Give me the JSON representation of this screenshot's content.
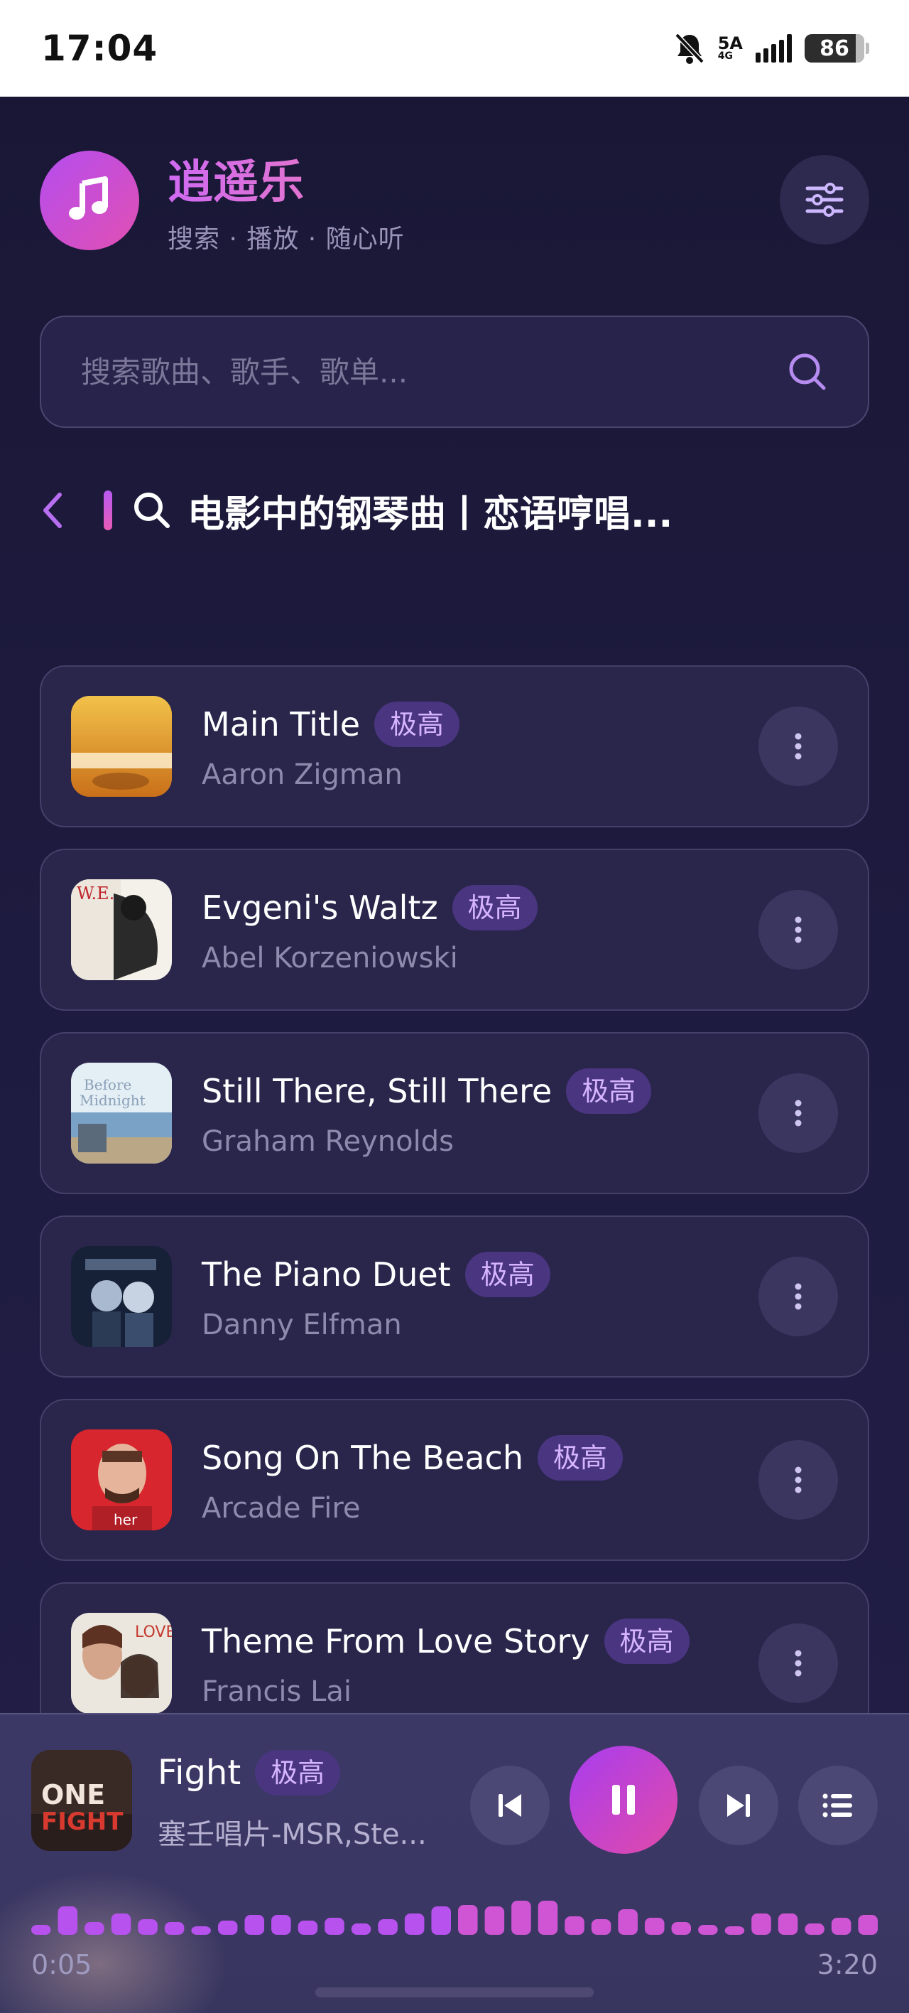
{
  "status_bar": {
    "time": "17:04",
    "network": "5A",
    "network_sub": "4G",
    "battery": "86"
  },
  "header": {
    "app_name": "逍遥乐",
    "subtitle": "搜索 · 播放 · 随心听"
  },
  "search": {
    "placeholder": "搜索歌曲、歌手、歌单..."
  },
  "list": {
    "title": "电影中的钢琴曲丨恋语哼唱..."
  },
  "songs": [
    {
      "title": "Main Title",
      "artist": "Aaron Zigman",
      "quality": "极高",
      "cover_colors": [
        "#f2c24a",
        "#c9701a"
      ]
    },
    {
      "title": "Evgeni's Waltz",
      "artist": "Abel Korzeniowski",
      "quality": "极高",
      "cover_colors": [
        "#f4f0ea",
        "#2a2a2a"
      ]
    },
    {
      "title": "Still There, Still There",
      "artist": "Graham Reynolds",
      "quality": "极高",
      "cover_colors": [
        "#dfeaf2",
        "#6d93b8"
      ]
    },
    {
      "title": "The Piano Duet",
      "artist": "Danny Elfman",
      "quality": "极高",
      "cover_colors": [
        "#1b2740",
        "#5a7190"
      ]
    },
    {
      "title": "Song On The Beach",
      "artist": "Arcade Fire",
      "quality": "极高",
      "cover_colors": [
        "#d8262e",
        "#f0c2a8"
      ]
    },
    {
      "title": "Theme From Love Story",
      "artist": "Francis Lai",
      "quality": "极高",
      "cover_colors": [
        "#e8e4dc",
        "#6a3a2a"
      ]
    }
  ],
  "player": {
    "title": "Fight",
    "quality": "极高",
    "artist": "塞壬唱片-MSR,Ste...",
    "elapsed": "0:05",
    "duration": "3:20",
    "cover_colors": [
      "#3a2a26",
      "#c8322c"
    ]
  },
  "colors": {
    "accent_purple": "#b44ef0",
    "accent_pink": "#e14fb2",
    "background": "#1b1838",
    "card": "#29254b"
  }
}
